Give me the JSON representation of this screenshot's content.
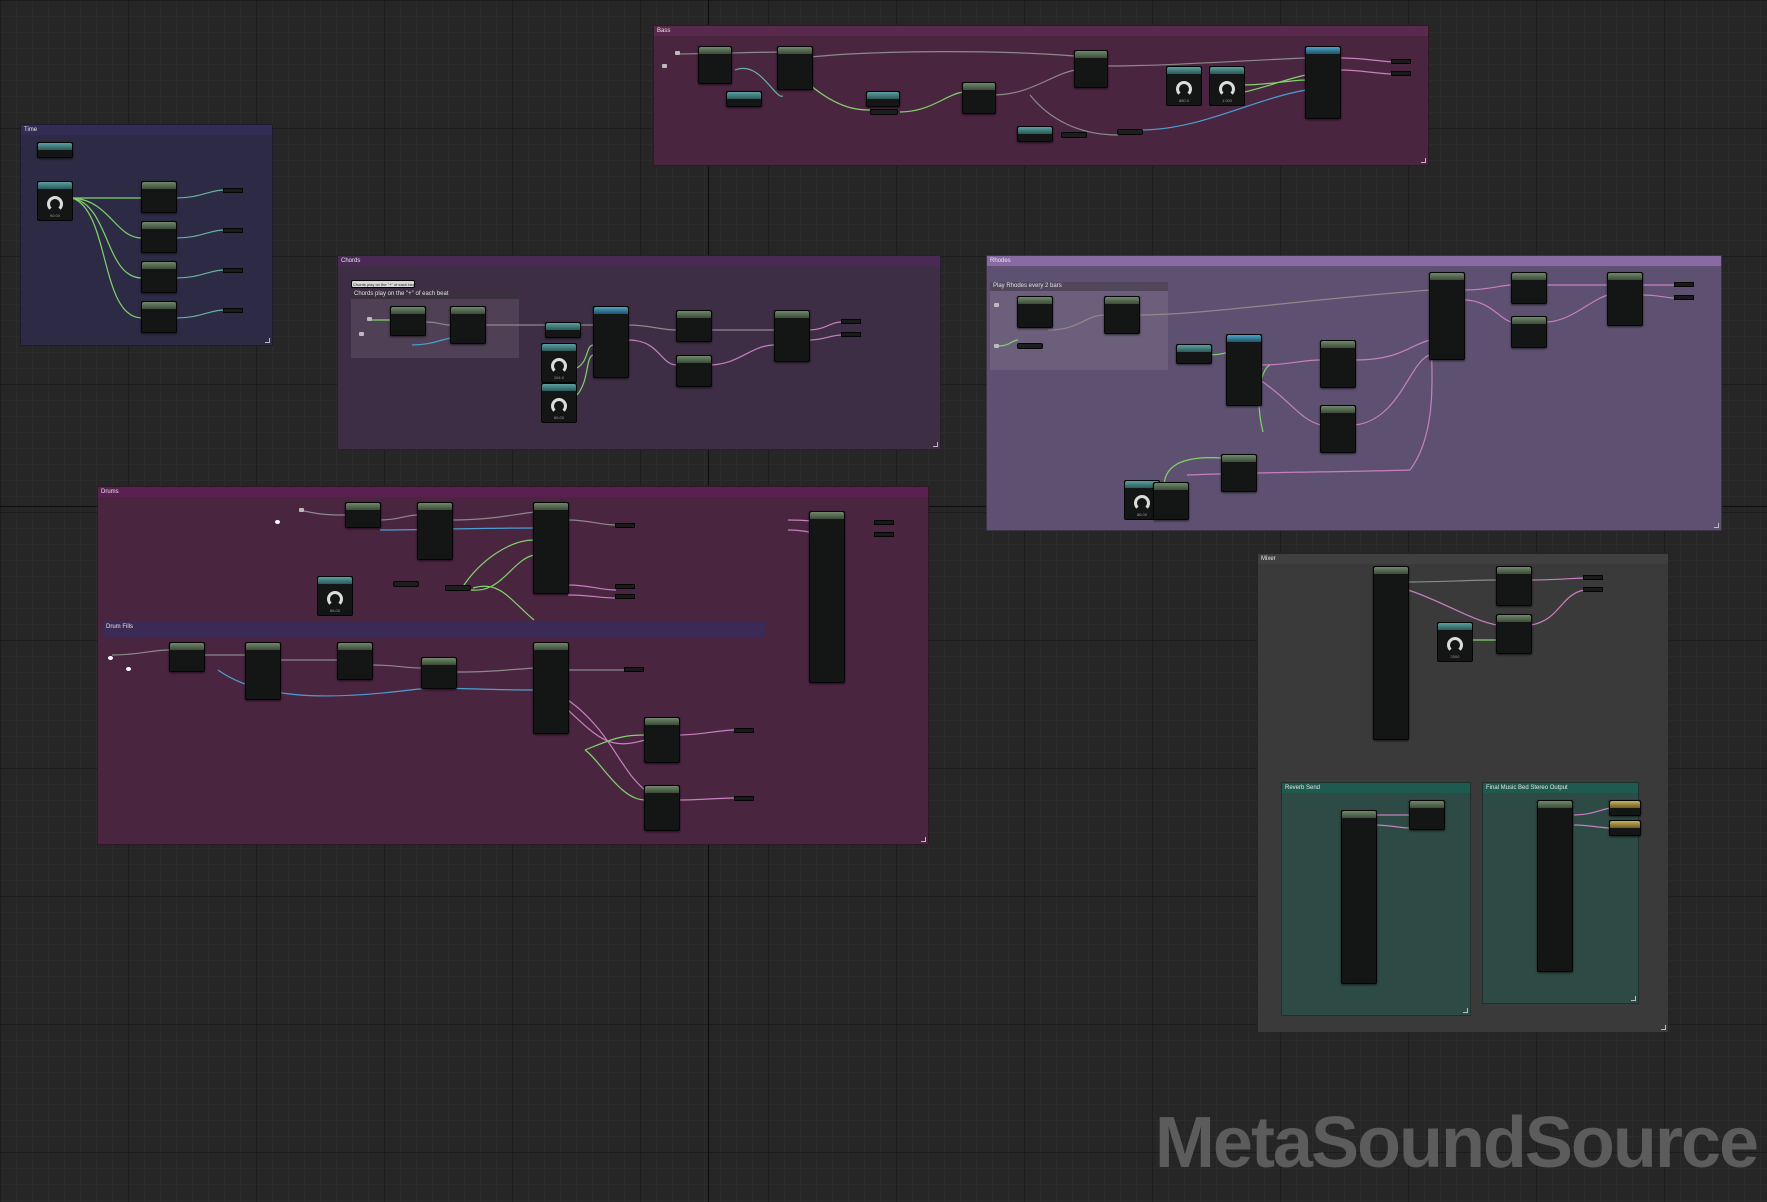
{
  "editor": {
    "watermark": "MetaSoundSource"
  },
  "comments": {
    "bass": "Bass",
    "time": "Time",
    "chords": "Chords",
    "chords_sub": "Chords play on the \"+\" of each beat",
    "chords_tag": "Chords play on the \"+\" of each beat",
    "rhodes": "Rhodes",
    "rhodes_sub": "Play Rhodes every 2 bars",
    "drums": "Drums",
    "drum_fills": "Drum Fills",
    "mixer": "Mixer",
    "reverb_send": "Reverb Send",
    "final_output": "Final Music Bed Stereo Output"
  },
  "knobs": {
    "time_knob": "90.00",
    "bass_knob_1": "880.0",
    "bass_knob_2": "1.000",
    "chords_knob_1": "264.0",
    "chords_knob_2": "86.00",
    "rhodes_knob": "86.00",
    "drums_knob": "86.00",
    "mixer_knob": "2000"
  },
  "colors": {
    "bass": "#4a2540",
    "time": "#2d2a45",
    "chords": "#3e2e45",
    "rhodes": "#5e5070",
    "drums": "#4a2540",
    "drum_fills": "#3b2a55",
    "mixer": "#3a3a3a",
    "reverb": "#2e4a44",
    "wire_exec": "#8a8a8a",
    "wire_audio": "#c77fc0",
    "wire_float": "#7fd46a",
    "wire_int": "#4a9fd0"
  }
}
